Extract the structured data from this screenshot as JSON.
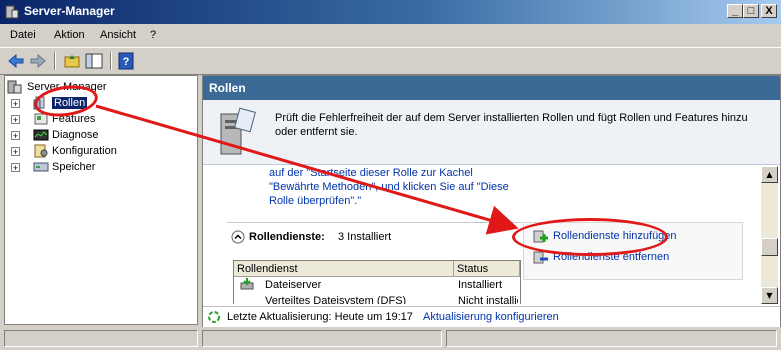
{
  "window": {
    "title": "Server-Manager",
    "min": "_",
    "max": "□",
    "close": "X"
  },
  "menu": [
    "Datei",
    "Aktion",
    "Ansicht",
    "?"
  ],
  "tree": {
    "root": "Server-Manager",
    "items": [
      {
        "label": "Rollen"
      },
      {
        "label": "Features"
      },
      {
        "label": "Diagnose"
      },
      {
        "label": "Konfiguration"
      },
      {
        "label": "Speicher"
      }
    ]
  },
  "pane": {
    "title": "Rollen",
    "description": "Prüft die Fehlerfreiheit der auf dem Server installierten Rollen und fügt Rollen und Features hinzu oder entfernt sie.",
    "partial_text_1": "auf der \"Startseite dieser Rolle zur Kachel",
    "partial_text_2": "\"Bewährte Methoden\", und klicken Sie auf \"Diese",
    "partial_text_3": "Rolle überprüfen\".\"",
    "section_title": "Rollendienste:",
    "section_count": "3 Installiert",
    "actions": {
      "add": "Rollendienste hinzufügen",
      "remove": "Rollendienste entfernen"
    },
    "table": {
      "headers": [
        "Rollendienst",
        "Status"
      ],
      "rows": [
        {
          "name": "Dateiserver",
          "status": "Installiert"
        },
        {
          "name": "Verteiltes Dateisystem (DFS)",
          "status": "Nicht installiert"
        }
      ]
    },
    "footer": {
      "refresh": "Letzte Aktualisierung: Heute um 19:17",
      "configure": "Aktualisierung konfigurieren"
    }
  },
  "colors": {
    "annotation": "#e01818",
    "header": "#3c6a97",
    "link": "#0033aa"
  }
}
